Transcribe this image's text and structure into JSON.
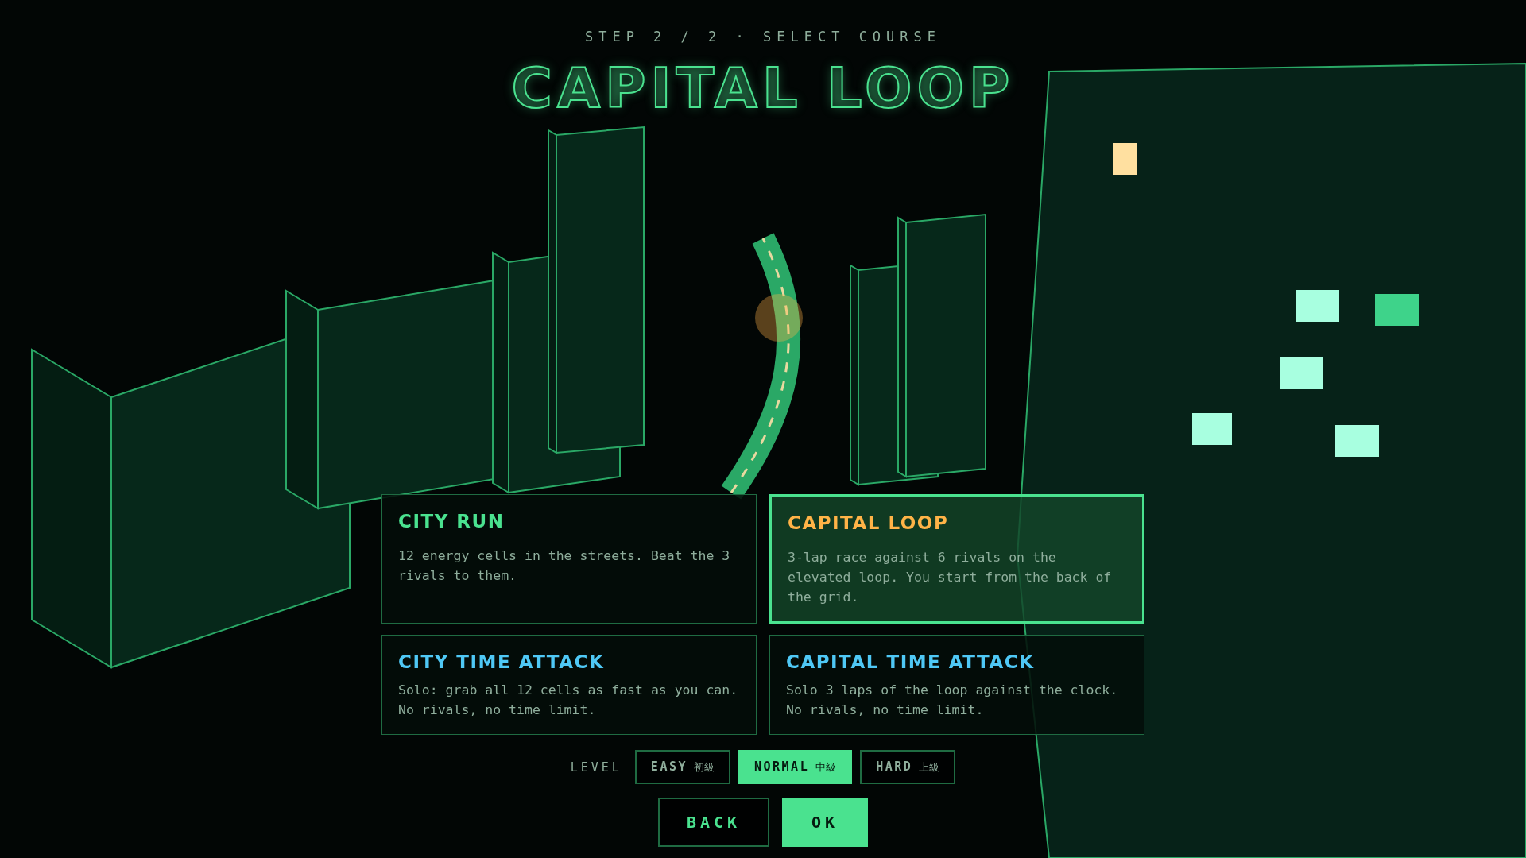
{
  "header": {
    "step": "STEP 2 / 2 · SELECT COURSE",
    "title": "CAPITAL LOOP"
  },
  "courses": [
    {
      "kind": "race",
      "title": "CITY RUN",
      "description": "12 energy cells in the streets. Beat the 3 rivals to them.",
      "selected": false
    },
    {
      "kind": "race",
      "title": "CAPITAL LOOP",
      "description": "3-lap race against 6 rivals on the elevated loop. You start from the back of the grid.",
      "selected": true
    },
    {
      "kind": "time_attack",
      "title": "CITY TIME ATTACK",
      "description": "Solo: grab all 12 cells as fast as you can. No rivals, no time limit.",
      "selected": false
    },
    {
      "kind": "time_attack",
      "title": "CAPITAL TIME ATTACK",
      "description": "Solo 3 laps of the loop against the clock. No rivals, no time limit.",
      "selected": false
    }
  ],
  "level": {
    "label": "LEVEL",
    "options": [
      {
        "label": "EASY",
        "kanji": "初級",
        "selected": false
      },
      {
        "label": "NORMAL",
        "kanji": "中級",
        "selected": true
      },
      {
        "label": "HARD",
        "kanji": "上級",
        "selected": false
      }
    ]
  },
  "buttons": [
    {
      "kind": "secondary",
      "label": "BACK"
    },
    {
      "kind": "primary",
      "label": "OK"
    }
  ]
}
